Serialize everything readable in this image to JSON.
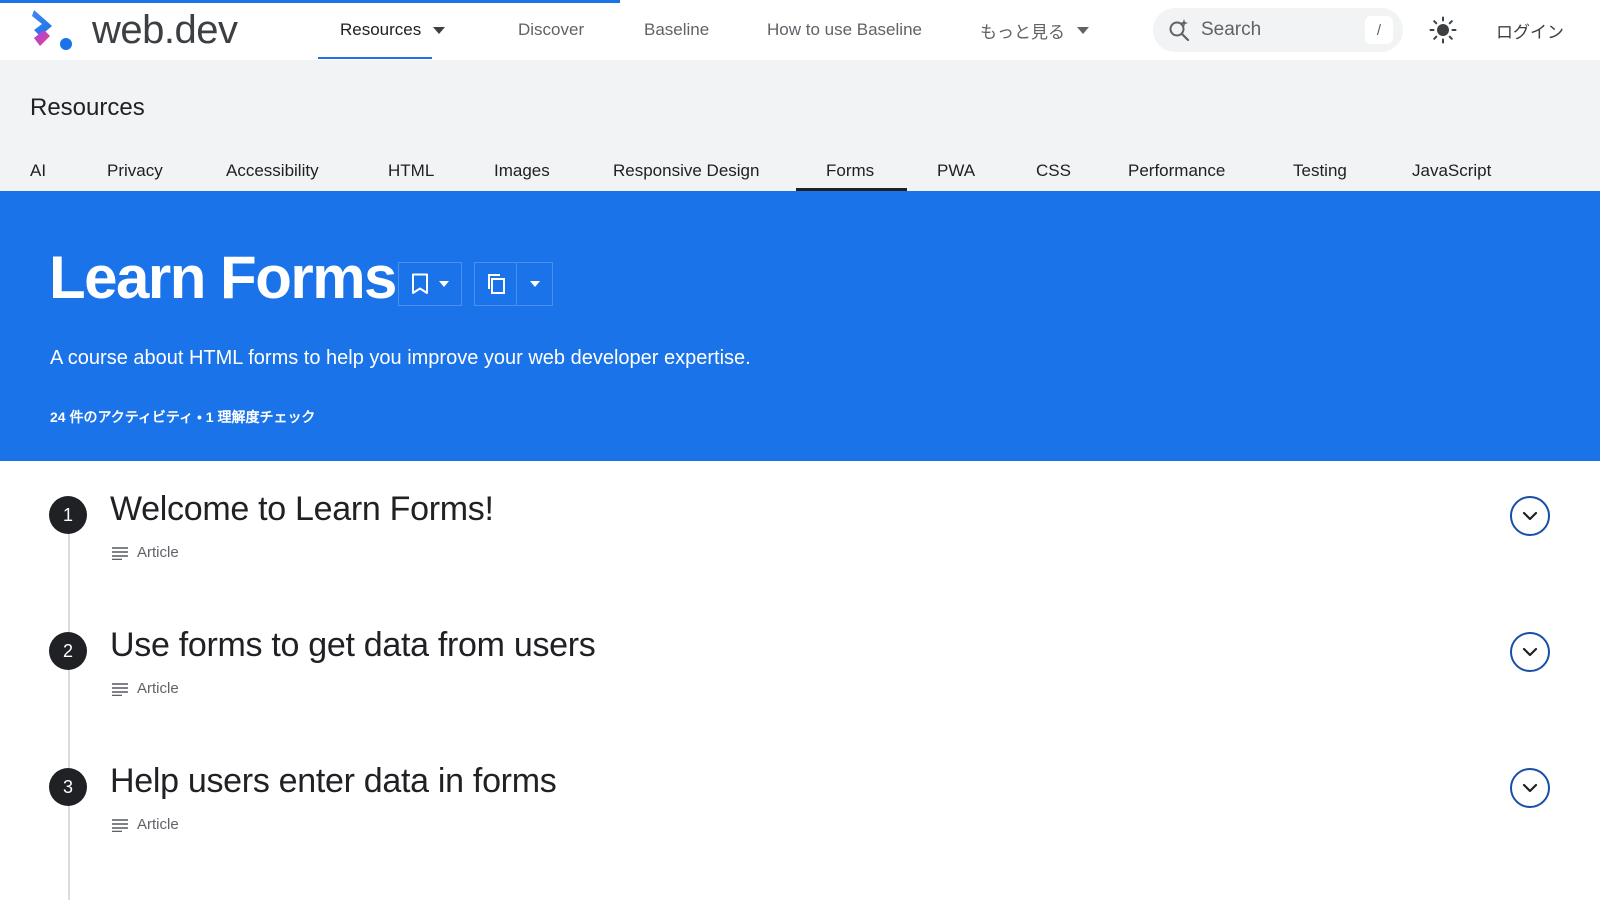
{
  "header": {
    "logo_text": "web.dev",
    "nav": [
      {
        "label": "Resources"
      },
      {
        "label": "Discover"
      },
      {
        "label": "Baseline"
      },
      {
        "label": "How to use Baseline"
      },
      {
        "label": "もっと見る"
      }
    ],
    "search_placeholder": "Search",
    "search_shortcut": "/",
    "login_label": "ログイン"
  },
  "resources": {
    "title": "Resources",
    "tabs": [
      {
        "label": "AI"
      },
      {
        "label": "Privacy"
      },
      {
        "label": "Accessibility"
      },
      {
        "label": "HTML"
      },
      {
        "label": "Images"
      },
      {
        "label": "Responsive Design"
      },
      {
        "label": "Forms"
      },
      {
        "label": "PWA"
      },
      {
        "label": "CSS"
      },
      {
        "label": "Performance"
      },
      {
        "label": "Testing"
      },
      {
        "label": "JavaScript"
      }
    ],
    "active_tab": "Forms"
  },
  "hero": {
    "title": "Learn Forms",
    "description": "A course about HTML forms to help you improve your web developer expertise.",
    "meta": "24 件のアクティビティ • 1 理解度チェック"
  },
  "course": {
    "items": [
      {
        "number": "1",
        "title": "Welcome to Learn Forms!",
        "type": "Article"
      },
      {
        "number": "2",
        "title": "Use forms to get data from users",
        "type": "Article"
      },
      {
        "number": "3",
        "title": "Help users enter data in forms",
        "type": "Article"
      }
    ]
  },
  "colors": {
    "accent": "#1a73e8",
    "hero_bg": "#1a73e8",
    "band_bg": "#f1f3f4",
    "expand_border": "#174ea6"
  },
  "icons": {
    "bookmark": "bookmark-icon",
    "copy": "copy-icon",
    "search": "search-spark-icon",
    "theme": "sun-icon",
    "article": "article-lines-icon",
    "expand": "chevron-down-icon"
  }
}
